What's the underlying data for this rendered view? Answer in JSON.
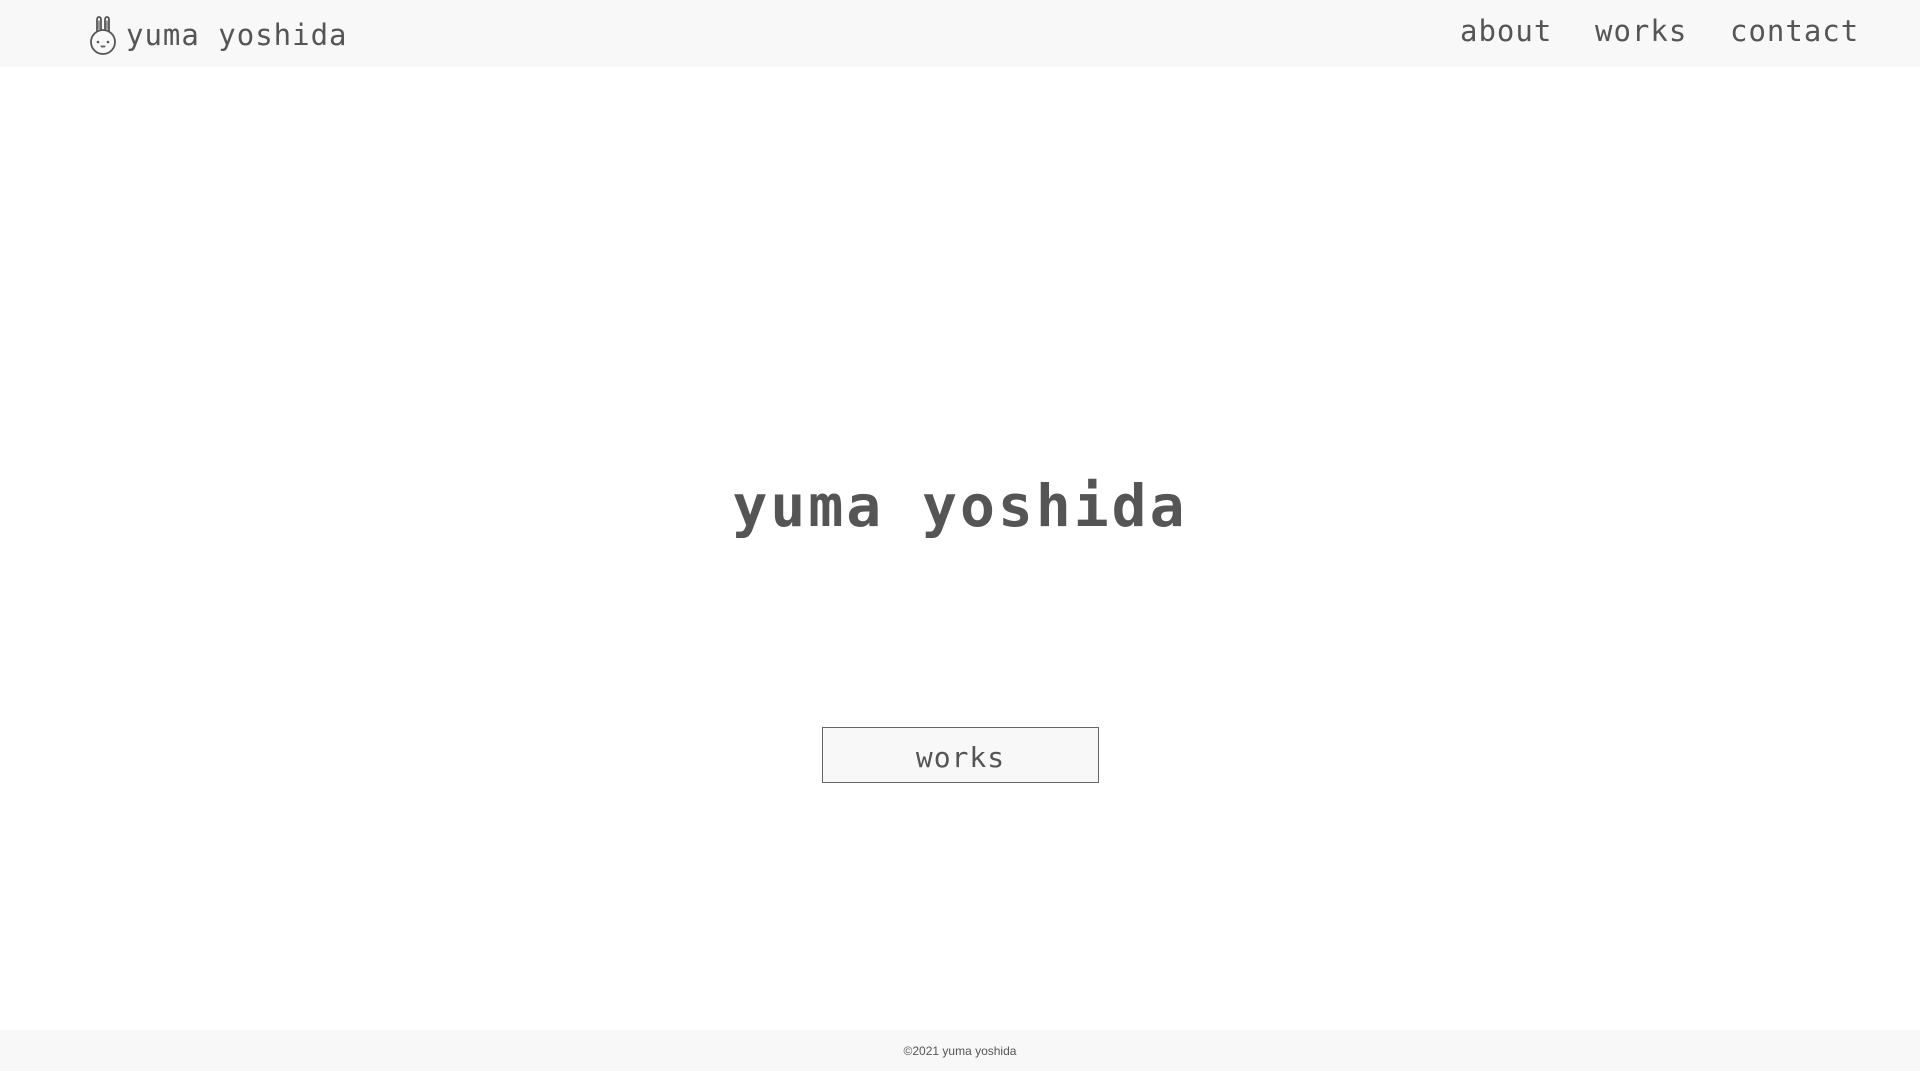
{
  "header": {
    "brand_name": "yuma yoshida",
    "brand_icon": "rabbit-icon",
    "nav": {
      "about": "about",
      "works": "works",
      "contact": "contact"
    }
  },
  "hero": {
    "title": "yuma yoshida",
    "button_label": "works"
  },
  "footer": {
    "copyright": "©2021 yuma yoshida"
  },
  "colors": {
    "text": "#555555",
    "header_bg": "#f8f8f8",
    "page_bg": "#ffffff",
    "button_border": "#666666"
  }
}
